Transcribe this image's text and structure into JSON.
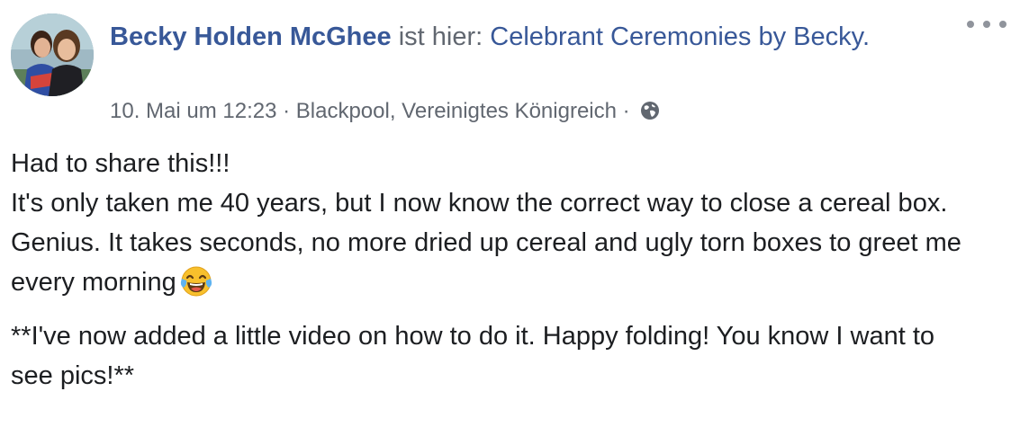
{
  "post": {
    "author_name": "Becky Holden McGhee",
    "checkin_text": " ist hier: ",
    "place_name": "Celebrant Ceremonies by Becky",
    "place_suffix": ".",
    "timestamp": "10. Mai um 12:23",
    "separator": " · ",
    "location": "Blackpool, Vereinigtes Königreich",
    "separator2": " · ",
    "privacy_icon": "globe-icon",
    "more_icon": "more-options-icon",
    "body": {
      "line1": "Had to share this!!!",
      "line2": "It's only taken me 40 years, but I now know the correct way to close a cereal box.",
      "line3": "Genius. It takes seconds, no more dried up cereal and ugly torn boxes to greet me every morning",
      "emoji": "face-with-tears-of-joy",
      "line4": "**I've now added a little video on how to do it. Happy folding! You know I want to see pics!**"
    }
  },
  "colors": {
    "link": "#385898",
    "meta": "#616770",
    "text": "#1c1e21",
    "icon": "#90949c"
  }
}
